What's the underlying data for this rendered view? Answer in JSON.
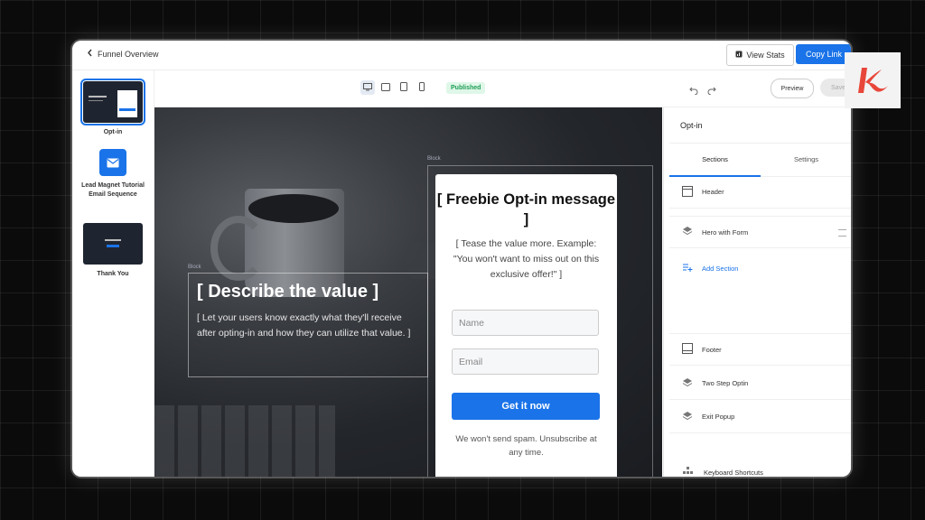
{
  "topbar": {
    "back_label": "Funnel Overview",
    "view_stats": "View Stats",
    "copy_link": "Copy Link"
  },
  "sidebar": {
    "steps": [
      {
        "label": "Opt-in"
      },
      {
        "label": "Lead Magnet Tutorial Email Sequence"
      },
      {
        "label": "Thank You"
      }
    ]
  },
  "toolbar": {
    "status": "Published",
    "preview": "Preview",
    "save": "Save"
  },
  "canvas": {
    "block_tag": "Block",
    "value_title": "[ Describe the value ]",
    "value_text": "[ Let your users know exactly what they'll receive after opting-in and how they can utilize that value. ]",
    "form": {
      "title": "[ Freebie Opt-in message ]",
      "subtitle": "[ Tease the value more. Example: \"You won't want to miss out on this exclusive offer!\" ]",
      "name_placeholder": "Name",
      "email_placeholder": "Email",
      "cta": "Get it now",
      "spam": "We won't send spam. Unsubscribe at any time."
    }
  },
  "panel": {
    "title": "Opt-in",
    "tabs": [
      "Sections",
      "Settings"
    ],
    "rows": [
      "Header",
      "Hero with Form",
      "Add Section",
      "Footer",
      "Two Step Optin",
      "Exit Popup",
      "Keyboard Shortcuts"
    ]
  },
  "colors": {
    "accent": "#1a73e8",
    "published": "#1f9d55",
    "logo": "#e8463a"
  }
}
